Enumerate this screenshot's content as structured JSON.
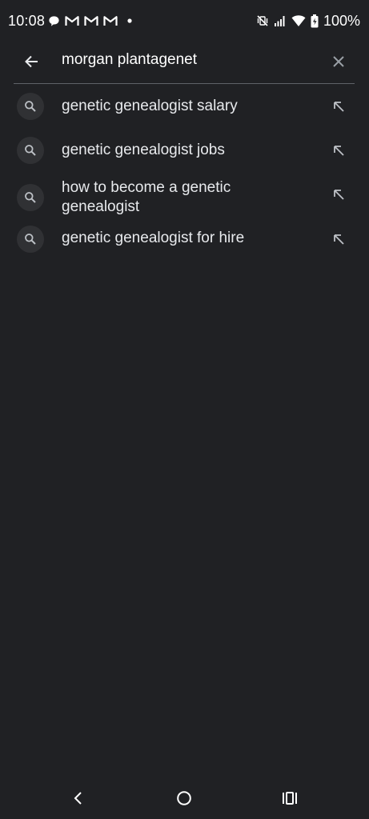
{
  "status_bar": {
    "time": "10:08",
    "battery": "100%",
    "left_icons": [
      "chat-bubble-icon",
      "gmail-icon",
      "gmail-icon",
      "gmail-icon",
      "dot-icon"
    ],
    "right_icons": [
      "vibrate-off-icon",
      "signal-icon",
      "wifi-icon",
      "battery-icon"
    ]
  },
  "search": {
    "query": "morgan plantagenet",
    "back_icon": "arrow-left-icon",
    "clear_icon": "close-icon"
  },
  "suggestions": [
    {
      "text": "genetic genealogist salary"
    },
    {
      "text": "genetic genealogist jobs"
    },
    {
      "text": "how to become a genetic genealogist"
    },
    {
      "text": "genetic genealogist for hire"
    }
  ],
  "nav_bar": {
    "icons": [
      "nav-back-icon",
      "nav-home-icon",
      "nav-recents-icon"
    ]
  },
  "colors": {
    "background": "#202124",
    "text": "#e8eaed",
    "icon_circle": "#303134",
    "divider": "#5f6368"
  }
}
